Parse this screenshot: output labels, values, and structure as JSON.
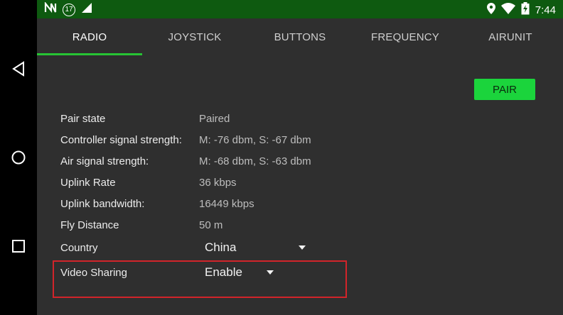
{
  "status_bar": {
    "notification_count": "17",
    "time": "7:44"
  },
  "tabs": [
    {
      "label": "RADIO"
    },
    {
      "label": "JOYSTICK"
    },
    {
      "label": "BUTTONS"
    },
    {
      "label": "FREQUENCY"
    },
    {
      "label": "AIRUNIT"
    }
  ],
  "pair_button": {
    "label": "PAIR"
  },
  "rows": [
    {
      "label": "Pair state",
      "value": "Paired"
    },
    {
      "label": "Controller signal strength:",
      "value": "M: -76 dbm, S: -67 dbm"
    },
    {
      "label": "Air signal strength:",
      "value": "M: -68 dbm, S: -63 dbm"
    },
    {
      "label": "Uplink Rate",
      "value": "36 kbps"
    },
    {
      "label": "Uplink bandwidth:",
      "value": "16449 kbps"
    },
    {
      "label": "Fly Distance",
      "value": "50 m"
    }
  ],
  "country": {
    "label": "Country",
    "value": "China"
  },
  "video_sharing": {
    "label": "Video Sharing",
    "value": "Enable"
  },
  "colors": {
    "status_bar": "#0e5a10",
    "tab_indicator": "#27c434",
    "pair_button": "#1bd43c",
    "highlight_box": "#d2242a",
    "background": "#2f2f2f"
  },
  "icons": {
    "navbar": [
      "back-icon",
      "home-icon",
      "recents-icon"
    ],
    "status_left": [
      "n-logo-icon",
      "notification-badge",
      "signal-icon"
    ],
    "status_right": [
      "location-icon",
      "wifi-icon",
      "battery-icon"
    ]
  }
}
